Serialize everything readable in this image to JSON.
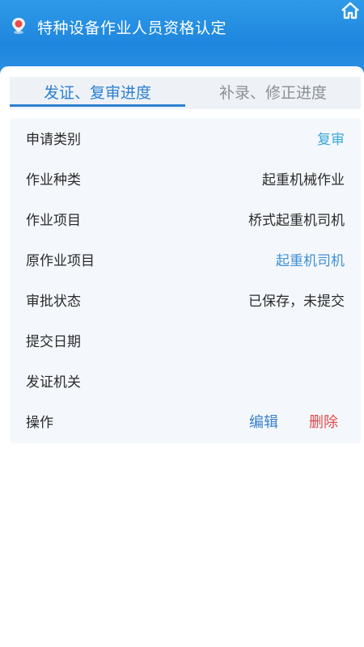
{
  "header": {
    "title": "特种设备作业人员资格认定"
  },
  "tabs": [
    {
      "label": "发证、复审进度"
    },
    {
      "label": "补录、修正进度"
    }
  ],
  "record": {
    "rows": [
      {
        "label": "申请类别",
        "value": "复审"
      },
      {
        "label": "作业种类",
        "value": "起重机械作业"
      },
      {
        "label": "作业项目",
        "value": "桥式起重机司机"
      },
      {
        "label": "原作业项目",
        "value": "起重机司机"
      },
      {
        "label": "审批状态",
        "value": "已保存，未提交"
      },
      {
        "label": "提交日期",
        "value": ""
      },
      {
        "label": "发证机关",
        "value": ""
      },
      {
        "label": "操作",
        "value": ""
      }
    ],
    "actions": {
      "edit": "编辑",
      "delete": "删除"
    }
  },
  "colors": {
    "header": "#1e86de",
    "accent": "#2c7fd0",
    "delete": "#e04a4a"
  }
}
